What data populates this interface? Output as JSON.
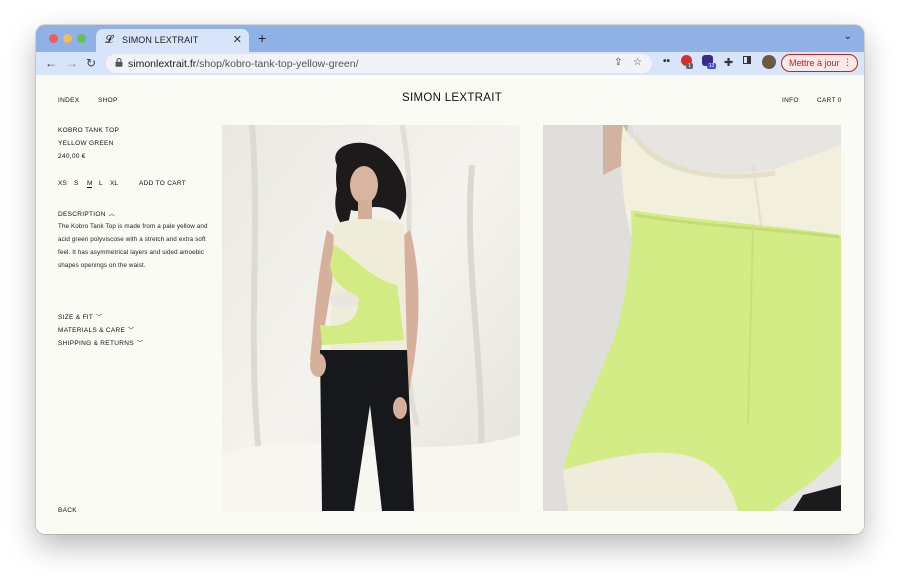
{
  "browser": {
    "tab": {
      "title": "SIMON LEXTRAIT",
      "icon": "brand-favicon-icon",
      "close": "✕"
    },
    "new_tab": "+",
    "tab_menu": "⌄",
    "nav": {
      "back": "←",
      "forward": "→",
      "reload": "↻"
    },
    "url": {
      "host": "simonlextrait.fr",
      "path": "/shop/kobro-tank-top-yellow-green/"
    },
    "badges": {
      "ext1": "1",
      "ext2": "13"
    },
    "update_button": "Mettre à jour",
    "menu": "⋮"
  },
  "site": {
    "nav": {
      "index": "INDEX",
      "shop": "SHOP",
      "info": "INFO",
      "cart": "CART 0"
    },
    "brand": "SIMON LEXTRAIT",
    "product": {
      "name_line1": "KOBRO TANK TOP",
      "name_line2": "YELLOW GREEN",
      "price": "240,00 €",
      "sizes": [
        "XS",
        "S",
        "M",
        "L",
        "XL"
      ],
      "selected_size": "M",
      "add_to_cart": "ADD TO CART",
      "description_label": "DESCRIPTION",
      "description": "The Kobro Tank Top is made from a pale yellow and acid green polyviscose with a stretch and extra soft feel. It has asymmetrical layers and sided amoebic shapes openings on the waist.",
      "accordions": [
        "SIZE & FIT",
        "MATERIALS & CARE",
        "SHIPPING & RETURNS"
      ]
    },
    "back": "BACK"
  },
  "colors": {
    "tabstrip": "#8fb1e6",
    "toolbar": "#d8e4f9",
    "page_bg": "#fbfbf5",
    "acid_green": "#d4ec86",
    "pale_yellow": "#f1efdc",
    "update_red": "#c5221f"
  }
}
